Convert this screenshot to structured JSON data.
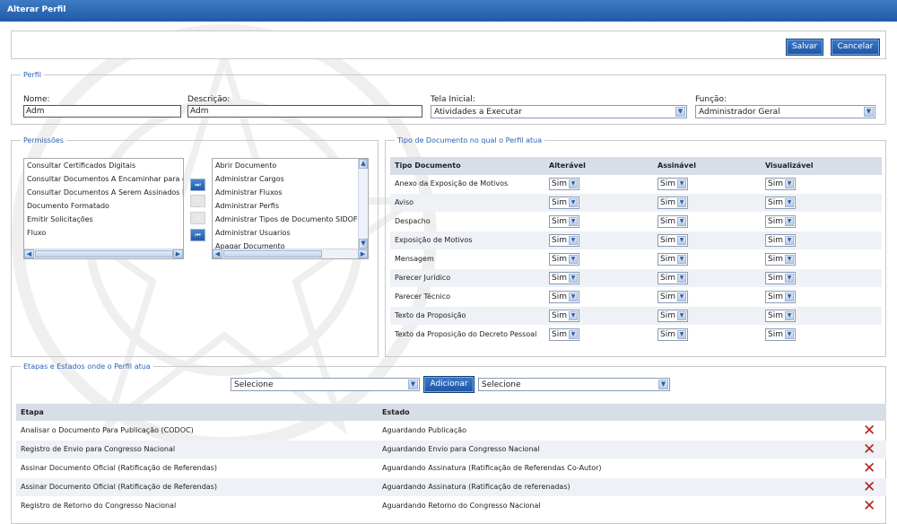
{
  "window": {
    "title": "Alterar Perfil"
  },
  "toolbar": {
    "save_label": "Salvar",
    "cancel_label": "Cancelar"
  },
  "perfil": {
    "legend": "Perfil",
    "nome_label": "Nome:",
    "nome_value": "Adm",
    "descricao_label": "Descrição:",
    "descricao_value": "Adm",
    "tela_label": "Tela Inicial:",
    "tela_value": "Atividades a Executar",
    "funcao_label": "Função:",
    "funcao_value": "Administrador Geral"
  },
  "permissoes": {
    "legend": "Permissões",
    "available": [
      "Consultar Certificados Digitais",
      "Consultar Documentos A Encaminhar para o PR",
      "Consultar Documentos A Serem Assinados Pelo PR",
      "Documento Formatado",
      "Emitir Solicitações",
      "Fluxo"
    ],
    "selected": [
      "Abrir Documento",
      "Administrar Cargos",
      "Administrar Fluxos",
      "Administrar Perfis",
      "Administrar Tipos de Documento SIDOF",
      "Administrar Usuarios",
      "Apagar Documento"
    ]
  },
  "tipos": {
    "legend": "Tipo de Documento no qual o Perfil atua",
    "headers": {
      "tipo": "Tipo Documento",
      "alteravel": "Alterável",
      "assinavel": "Assinável",
      "visualizavel": "Visualizável"
    },
    "rows": [
      {
        "tipo": "Anexo da Exposição de Motivos",
        "alteravel": "Sim",
        "assinavel": "Sim",
        "visualizavel": "Sim"
      },
      {
        "tipo": "Aviso",
        "alteravel": "Sim",
        "assinavel": "Sim",
        "visualizavel": "Sim"
      },
      {
        "tipo": "Despacho",
        "alteravel": "Sim",
        "assinavel": "Sim",
        "visualizavel": "Sim"
      },
      {
        "tipo": "Exposição de Motivos",
        "alteravel": "Sim",
        "assinavel": "Sim",
        "visualizavel": "Sim"
      },
      {
        "tipo": "Mensagem",
        "alteravel": "Sim",
        "assinavel": "Sim",
        "visualizavel": "Sim"
      },
      {
        "tipo": "Parecer Jurídico",
        "alteravel": "Sim",
        "assinavel": "Sim",
        "visualizavel": "Sim"
      },
      {
        "tipo": "Parecer Técnico",
        "alteravel": "Sim",
        "assinavel": "Sim",
        "visualizavel": "Sim"
      },
      {
        "tipo": "Texto da Proposição",
        "alteravel": "Sim",
        "assinavel": "Sim",
        "visualizavel": "Sim"
      },
      {
        "tipo": "Texto da Proposição do Decreto Pessoal",
        "alteravel": "Sim",
        "assinavel": "Sim",
        "visualizavel": "Sim"
      }
    ]
  },
  "etapas": {
    "legend": "Etapas e Estados onde o Perfil atua",
    "etapa_select": "Selecione",
    "add_label": "Adicionar",
    "estado_select": "Selecione",
    "headers": {
      "etapa": "Etapa",
      "estado": "Estado"
    },
    "rows": [
      {
        "etapa": "Analisar o Documento Para Publicação (CODOC)",
        "estado": "Aguardando Publicação"
      },
      {
        "etapa": "Registro de Envio para Congresso Nacional",
        "estado": "Aguardando Envio para Congresso Nacional"
      },
      {
        "etapa": "Assinar Documento Oficial (Ratificação de Referendas)",
        "estado": "Aguardando Assinatura (Ratificação de Referendas Co-Autor)"
      },
      {
        "etapa": "Assinar Documento Oficial (Ratificação de Referendas)",
        "estado": "Aguardando Assinatura (Ratificação de referenadas)"
      },
      {
        "etapa": "Registro de Retorno do Congresso Nacional",
        "estado": "Aguardando Retorno do Congresso Nacional"
      }
    ]
  }
}
